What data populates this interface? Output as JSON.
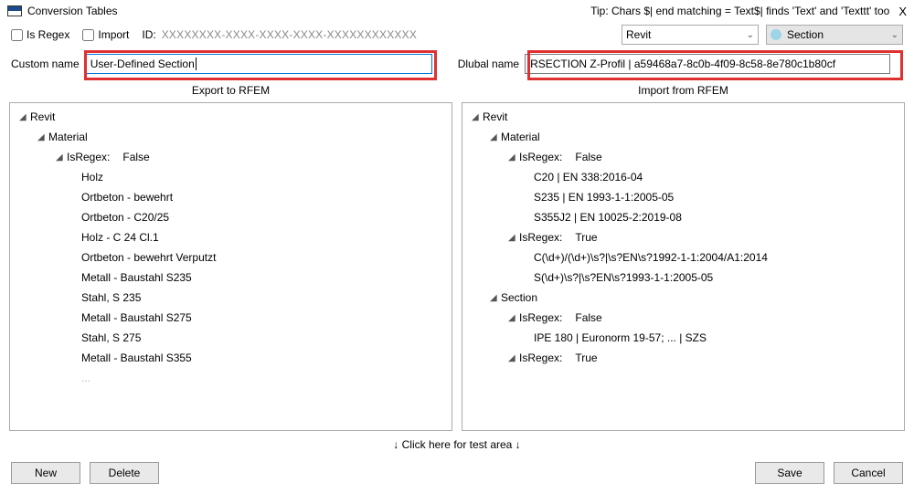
{
  "titlebar": {
    "title": "Conversion Tables",
    "tip": "Tip: Chars $| end matching = Text$| finds 'Text' and 'Texttt' too",
    "close": "X"
  },
  "row1": {
    "is_regex": "Is Regex",
    "import": "Import",
    "id_label": "ID:",
    "id_mask": "XXXXXXXX-XXXX-XXXX-XXXX-XXXXXXXXXXXX",
    "combo_app": "Revit",
    "combo_type": "Section"
  },
  "row2": {
    "custom_label": "Custom name",
    "custom_value": "User-Defined Section",
    "dlubal_label": "Dlubal name",
    "dlubal_value": "RSECTION Z-Profil | a59468a7-8c0b-4f09-8c58-8e780c1b80cf"
  },
  "panels": {
    "export_title": "Export to RFEM",
    "import_title": "Import from RFEM"
  },
  "tree_export": {
    "root": "Revit",
    "material": "Material",
    "isregex_label": "IsRegex:",
    "isregex_false": "False",
    "items": [
      "Holz",
      "Ortbeton - bewehrt",
      "Ortbeton - C20/25",
      "Holz - C 24 Cl.1",
      "Ortbeton - bewehrt Verputzt",
      "Metall - Baustahl S235",
      "Stahl, S 235",
      "Metall - Baustahl S275",
      "Stahl, S 275",
      "Metall - Baustahl S355"
    ]
  },
  "tree_import": {
    "root": "Revit",
    "material": "Material",
    "isregex_label": "IsRegex:",
    "isregex_false": "False",
    "isregex_true": "True",
    "section": "Section",
    "mat_false_items": [
      "C20 | EN 338:2016-04",
      "S235 | EN 1993-1-1:2005-05",
      "S355J2 | EN 10025-2:2019-08"
    ],
    "mat_true_items": [
      "C(\\d+)/(\\d+)\\s?|\\s?EN\\s?1992-1-1:2004/A1:2014",
      "S(\\d+)\\s?|\\s?EN\\s?1993-1-1:2005-05"
    ],
    "sec_false_items": [
      "IPE 180 | Euronorm 19-57; ... | SZS"
    ]
  },
  "test_area": "↓ Click here for test area ↓",
  "buttons": {
    "new": "New",
    "delete": "Delete",
    "save": "Save",
    "cancel": "Cancel"
  }
}
